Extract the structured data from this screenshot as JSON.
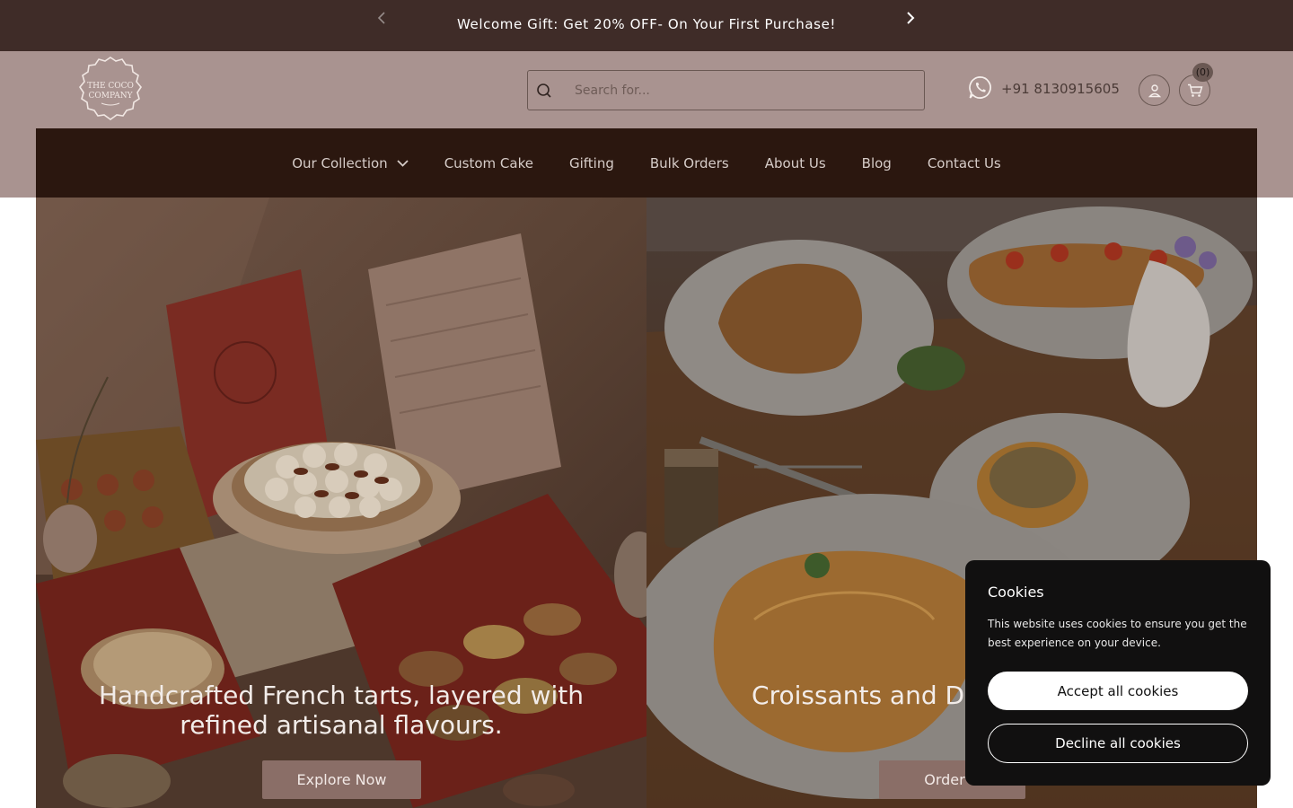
{
  "announcement": {
    "message": "Welcome Gift: Get 20% OFF- On Your First Purchase!",
    "prev_icon": "chevron-left-icon",
    "next_icon": "chevron-right-icon"
  },
  "header": {
    "logo_line1": "THE COCO",
    "logo_line2": "COMPANY",
    "search_placeholder": "Search for...",
    "phone": "+91 8130915605",
    "cart_count": "(0)",
    "icons": [
      "search-icon",
      "whatsapp-icon",
      "user-icon",
      "cart-icon"
    ]
  },
  "nav": {
    "items": [
      {
        "label": "Our Collection"
      },
      {
        "label": "Custom Cake"
      },
      {
        "label": "Gifting"
      },
      {
        "label": "Bulk Orders"
      },
      {
        "label": "About Us"
      },
      {
        "label": "Blog"
      },
      {
        "label": "Contact Us"
      }
    ]
  },
  "hero": {
    "left": {
      "headline": "Handcrafted French tarts, layered with refined artisanal flavours.",
      "cta": "Explore Now"
    },
    "right": {
      "headline": "Croissants and D Savoury. Perfe",
      "cta": "Order N"
    }
  },
  "cookie": {
    "title": "Cookies",
    "text": "This website uses cookies to ensure you get the best experience on your device.",
    "accept": "Accept all cookies",
    "decline": "Decline all cookies"
  },
  "colors": {
    "announcement_bg": "#3f2c28",
    "header_bg": "#a99390",
    "nav_bg": "#2b170f",
    "cta_bg": "#8a6e67",
    "cookie_bg": "#111010"
  }
}
